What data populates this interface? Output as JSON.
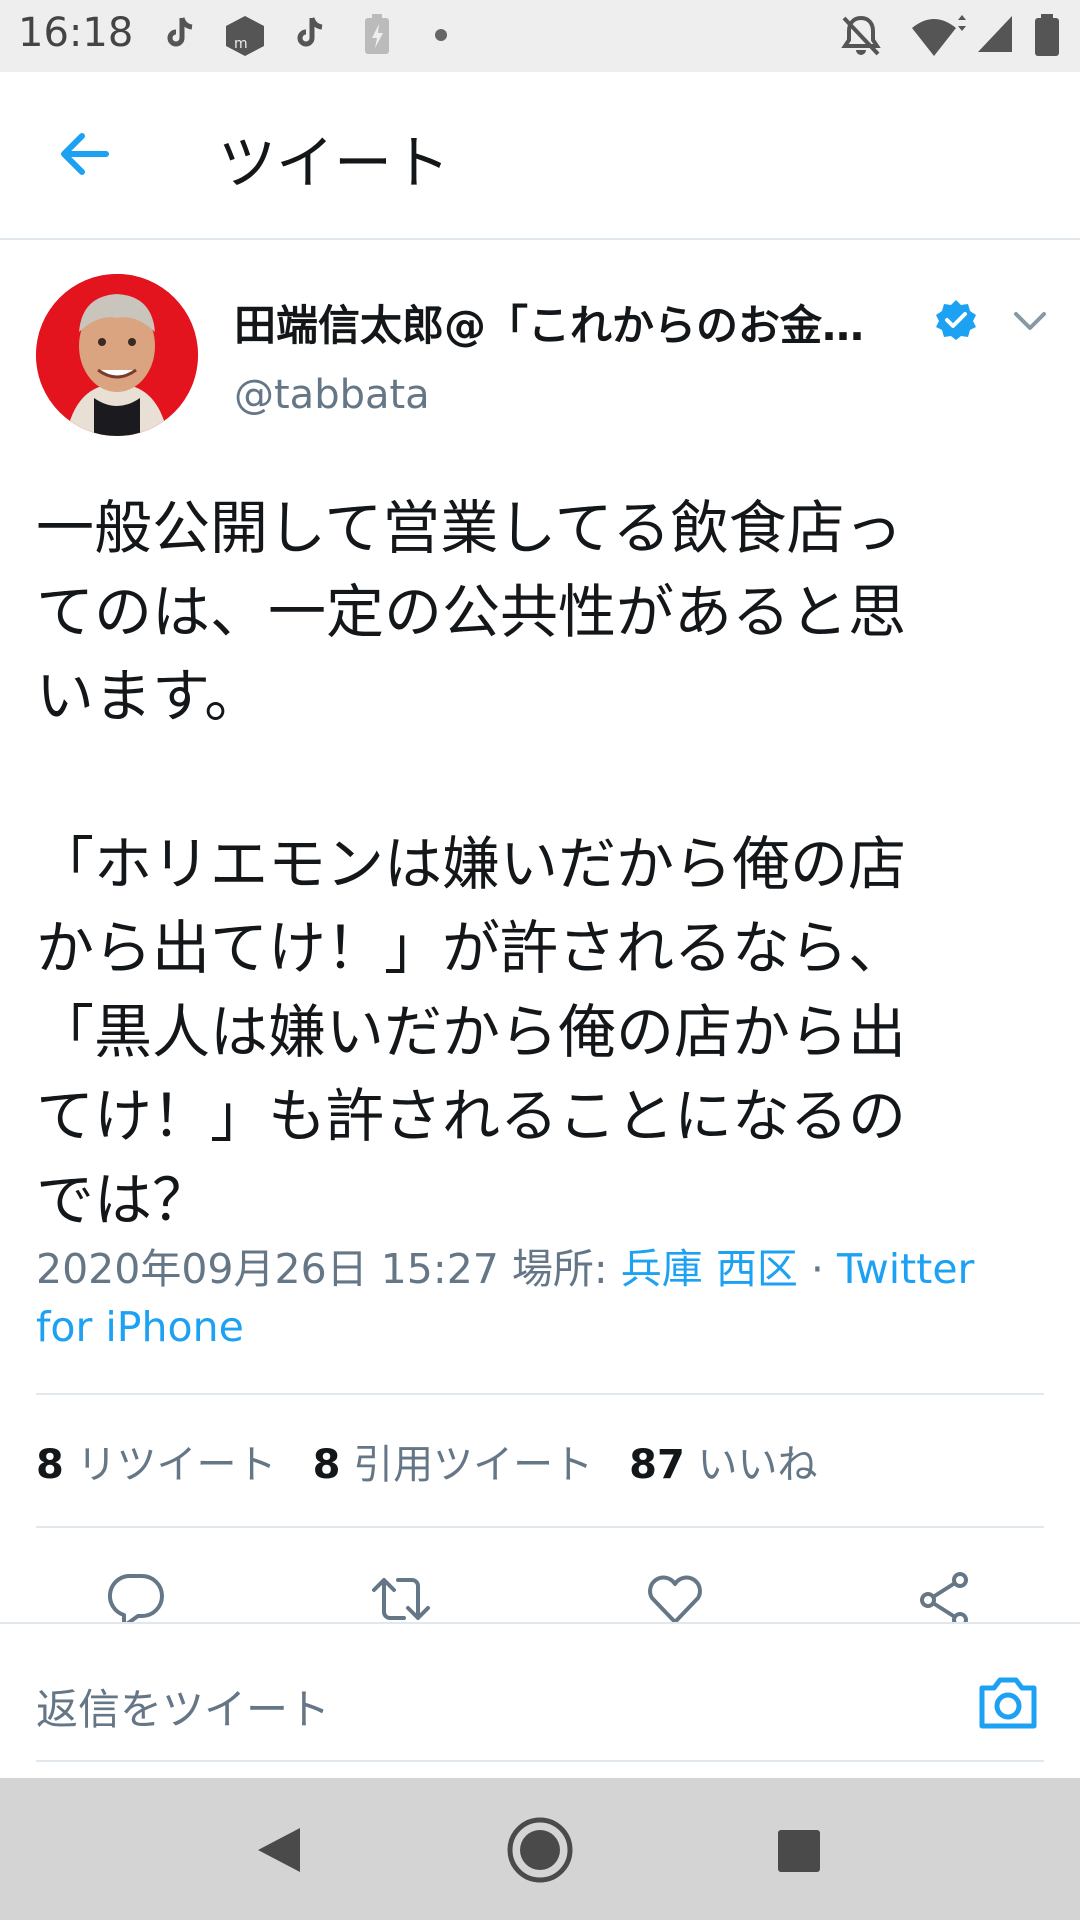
{
  "status_bar": {
    "time": "16:18"
  },
  "header": {
    "title": "ツイート"
  },
  "tweet": {
    "author_name": "田端信太郎@「これからのお金…",
    "author_handle": "@tabbata",
    "text": "一般公開して営業してる飲食店っ\nてのは、一定の公共性があると思\nいます。\n\n「ホリエモンは嫌いだから俺の店\nから出てけ！」が許されるなら、\n「黒人は嫌いだから俺の店から出\nてけ！」も許されることになるの\nでは？",
    "timestamp": "2020年09月26日 15:27",
    "location_label": "場所:",
    "location": "兵庫 西区",
    "separator": "·",
    "source": "Twitter for iPhone"
  },
  "stats": {
    "retweets_count": "8",
    "retweets_label": "リツイート",
    "quotes_count": "8",
    "quotes_label": "引用ツイート",
    "likes_count": "87",
    "likes_label": "いいね"
  },
  "reply": {
    "placeholder": "返信をツイート"
  },
  "colors": {
    "accent": "#1da1f2",
    "secondary_text": "#657786",
    "avatar_bg": "#e3141e"
  }
}
